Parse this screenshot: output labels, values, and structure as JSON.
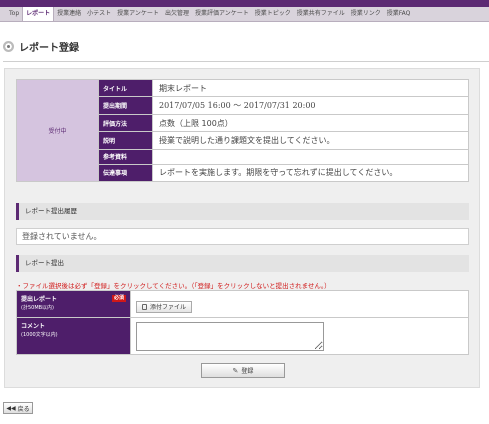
{
  "nav": {
    "tabs": [
      {
        "label": "Top",
        "active": false
      },
      {
        "label": "レポート",
        "active": true
      },
      {
        "label": "授業連絡",
        "active": false
      },
      {
        "label": "小テスト",
        "active": false
      },
      {
        "label": "授業アンケート",
        "active": false
      },
      {
        "label": "出欠管理",
        "active": false
      },
      {
        "label": "授業評価アンケート",
        "active": false
      },
      {
        "label": "授業トピック",
        "active": false
      },
      {
        "label": "授業共有ファイル",
        "active": false
      },
      {
        "label": "授業リンク",
        "active": false
      },
      {
        "label": "授業FAQ",
        "active": false
      }
    ]
  },
  "page": {
    "title": "レポート登録"
  },
  "report": {
    "status": "受付中",
    "rows": [
      {
        "label": "タイトル",
        "value": "期末レポート"
      },
      {
        "label": "提出期間",
        "value": "2017/07/05 16:00 〜 2017/07/31 20:00"
      },
      {
        "label": "評価方法",
        "value": "点数（上限 100点）"
      },
      {
        "label": "説明",
        "value": "授業で説明した通り課題文を提出してください。"
      },
      {
        "label": "参考資料",
        "value": ""
      },
      {
        "label": "伝達事項",
        "value": "レポートを実施します。期限を守って忘れずに提出してください。"
      }
    ]
  },
  "history": {
    "header": "レポート提出履歴",
    "empty_text": "登録されていません。"
  },
  "submit": {
    "header": "レポート提出",
    "warning": "・ファイル選択後は必ず「登録」をクリックしてください。（「登録」をクリックしないと提出されません。）",
    "file_label": "提出レポート",
    "file_sub": "(計50MB以内)",
    "required": "必須",
    "attach_label": "添付ファイル",
    "comment_label": "コメント",
    "comment_sub": "(1000文字以内)",
    "register_label": "登録"
  },
  "back_label": "戻る",
  "colors": {
    "brand": "#5c2a73",
    "label_bg": "#4e1e6a",
    "status_bg": "#d5c4df",
    "warning": "#d01818"
  }
}
